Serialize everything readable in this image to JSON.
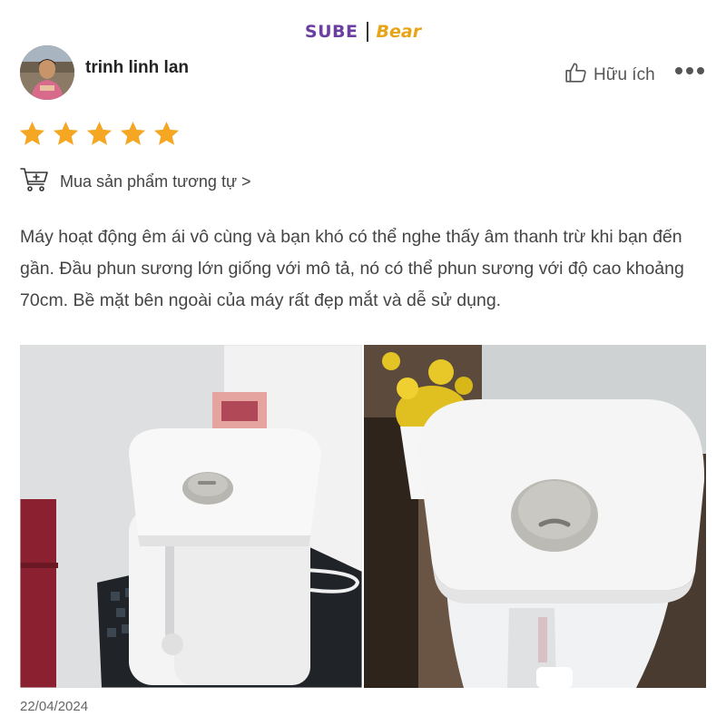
{
  "brand": {
    "left_text": "SUBE",
    "right_text": "Bear"
  },
  "review": {
    "user_name": "trinh linh lan",
    "helpful_label": "Hữu ích",
    "rating": 5,
    "rating_max": 5,
    "buy_similar_label": "Mua sản phẩm tương tự >",
    "text": "Máy hoạt động êm ái vô cùng và bạn khó có thể nghe thấy âm thanh trừ khi bạn đến gần. Đầu phun sương lớn giống với mô tả, nó có thể phun sương với độ cao khoảng 70cm. Bề mặt bên ngoài của máy rất đẹp mắt và dễ sử dụng.",
    "date": "22/04/2024",
    "photos": [
      "humidifier-photo-wide",
      "humidifier-photo-closeup"
    ]
  },
  "colors": {
    "star": "#f5a623",
    "brand_purple": "#6a3fa0",
    "brand_orange": "#e8a417"
  }
}
